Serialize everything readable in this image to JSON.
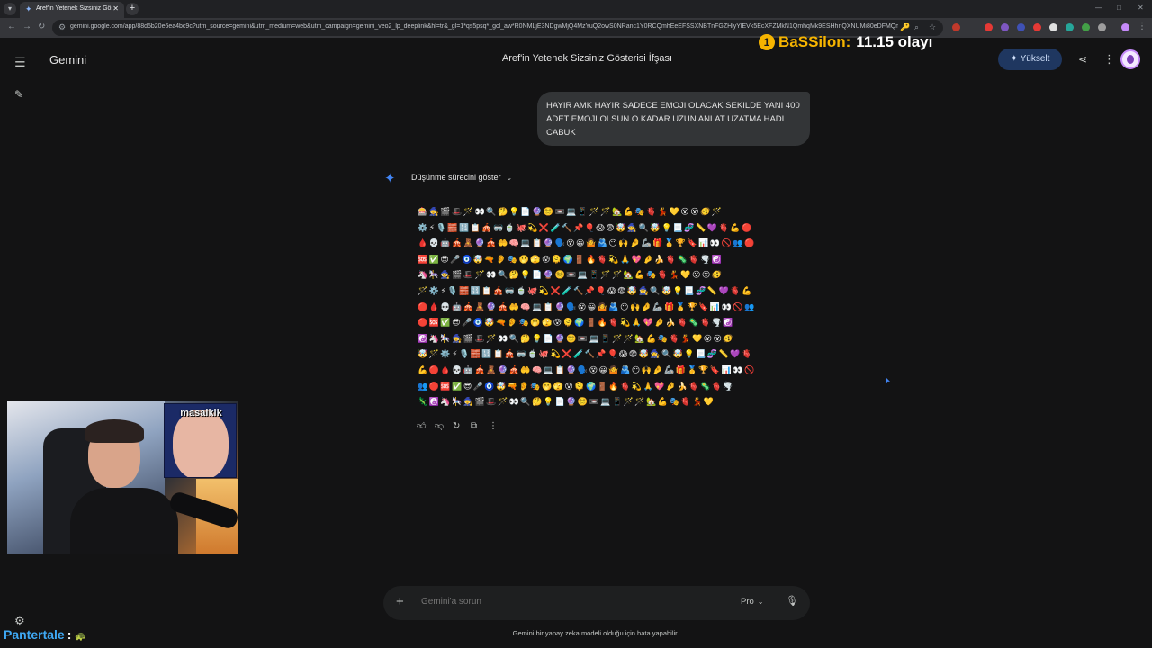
{
  "browser": {
    "tab_title": "Aref'in Yetenek Sizsiniz Gösterisi",
    "url": "gemini.google.com/app/88d5b20e6ea4bc9c?utm_source=gemini&utm_medium=web&utm_campaign=gemini_veo2_lp_deeplink&hl=tr&_gl=1*qs5psq*_gcl_aw*R0NMLjE3NDgwMjQ4MzYuQ2owS0NRanc1Y0RCQmhEeEFSSXNBTnFGZHlyYlEVk5EcXFZMkN1QmhqMk9ESHhnQXNUMi80eDFMQmZ..."
  },
  "header": {
    "brand": "Gemini",
    "conversation_title": "Aref'in Yetenek Sizsiniz Gösterisi İfşası",
    "upgrade_label": "Yükselt"
  },
  "chat": {
    "user_message": "HAYIR AMK HAYIR SADECE EMOJI OLACAK SEKILDE YANI 400 ADET EMOJI OLSUN O KADAR UZUN ANLAT UZATMA HADI CABUK",
    "show_thinking_label": "Düşünme sürecini göster",
    "emoji_rows": [
      "🎰🧙🎬🎩🪄👀🔍🤔💡📄🔮😵‍💫📼💻📱🪄🪄🏡💪🎭🫀💃💛😮😮🫨🪄",
      "⚙️⚡🎙️🧱🔢📋🎪🥽🍵🐙💫❌🧪🔨📌🎈😱😨🤯🧙🔍🤯💡📃🧬📏💜🫀💪🔴",
      "🩸💀🤖🎪🧸🔮🎪🤲🧠💻📋🔮🗣️😵😀🤷🫂😶🙌🤌🦾🎁🥇🏆🔖📊👀🚫👥🔴",
      "🆘✅😎🎤🧿🤯🔫👂🎭🫢🫣😰🫠🌍🚪🔥🫀💫🙏💖🤌🍌🫀🦠🫀🌪️☯️",
      "🦄🎠🧙🎬🎩🪄👀🔍🤔💡📄🔮😵‍💫📼💻📱🪄🪄🏡💪🎭🫀💃💛😮😮🫨",
      "🪄⚙️⚡🎙️🧱🔢📋🎪🥽🍵🐙💫❌🧪🔨📌🎈😱😨🤯🧙🔍🤯💡📃🧬📏💜🫀💪",
      "🔴🩸💀🤖🎪🧸🔮🎪🤲🧠💻📋🔮🗣️😵😀🤷🫂😶🙌🤌🦾🎁🥇🏆🔖📊👀🚫👥",
      "🔴🆘✅😎🎤🧿🤯🔫👂🎭🫢🫣😰🫠🌍🚪🔥🫀💫🙏💖🤌🍌🫀🦠🫀🌪️☯️",
      "☯️🦄🎠🧙🎬🎩🪄👀🔍🤔💡📄🔮😵‍💫📼💻📱🪄🪄🏡💪🎭🫀💃💛😮😮🫨",
      "🤯🪄⚙️⚡🎙️🧱🔢📋🎪🥽🍵🐙💫❌🧪🔨📌🎈😱😨🤯🧙🔍🤯💡📃🧬📏💜🫀",
      "💪🔴🩸💀🤖🎪🧸🔮🎪🤲🧠💻📋🔮🗣️😵😀🤷🫂😶🙌🤌🦾🎁🥇🏆🔖📊👀🚫",
      "👥🔴🆘✅😎🎤🧿🤯🔫👂🎭🫢🫣😰🫠🌍🚪🔥🫀💫🙏💖🤌🍌🫀🦠🫀🌪️",
      "🦎☯️🦄🎠🧙🎬🎩🪄👀🔍🤔💡📄🔮😵‍💫📼💻📱🪄🪄🏡💪🎭🫀💃💛"
    ]
  },
  "composer": {
    "placeholder": "Gemini'a sorun",
    "model": "Pro",
    "disclaimer": "Gemini bir yapay zeka modeli olduğu için hata yapabilir."
  },
  "overlay": {
    "sub_rank": "1",
    "sub_name": "BaSSilon:",
    "sub_text": "11.15 olayı",
    "inset_label": "masaikik",
    "follower_name": "Pantertale",
    "follower_colon": ":"
  },
  "icons": {
    "menu": "menu-icon",
    "new_chat": "edit-icon",
    "settings": "settings-icon",
    "share": "share-icon",
    "more": "more-vert-icon",
    "sparkle": "gemini-sparkle-icon",
    "plus": "plus-icon",
    "mic": "mic-icon"
  },
  "colors": {
    "background": "#131314",
    "upgrade_bg": "#1f3760",
    "sparkle": "#4285f4",
    "sub_name": "#f6b400",
    "follower_name": "#3fa9f5"
  }
}
